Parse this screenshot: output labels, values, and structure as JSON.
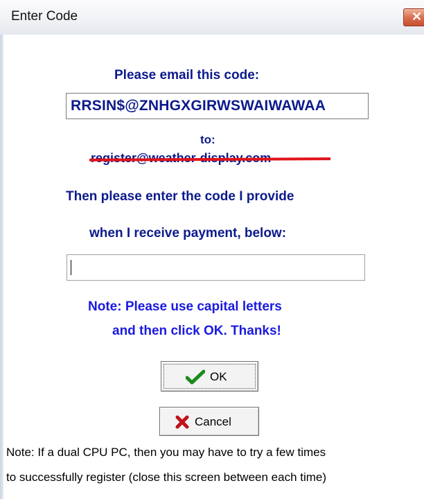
{
  "window": {
    "title": "Enter Code",
    "close_glyph": "✕"
  },
  "dialog": {
    "email_prompt": "Please email this code:",
    "code_value": "RRSIN$@ZNHGXGIRWSWAIWAWAA",
    "to_label": "to:",
    "email_address": "register@weather-display.com",
    "instruction_line1": "Then please enter the code I provide",
    "instruction_line2": "when I receive payment, below:",
    "entry_value": "",
    "note_line1": "Note: Please use capital letters",
    "note_line2": "and then click OK. Thanks!",
    "ok_label": "OK",
    "ok_icon": "checkmark-icon",
    "cancel_label": "Cancel",
    "cancel_icon": "red-x-icon",
    "footnote_line1": "Note: If a dual CPU PC, then you may have to try a few times",
    "footnote_line2": "to successfully register (close this screen between each time)"
  },
  "colors": {
    "text_blue": "#0c1a8c",
    "note_blue": "#1a1ae0",
    "strike_red": "#e0141a",
    "check_green": "#1a8a1a",
    "cancel_red": "#c0101a"
  }
}
